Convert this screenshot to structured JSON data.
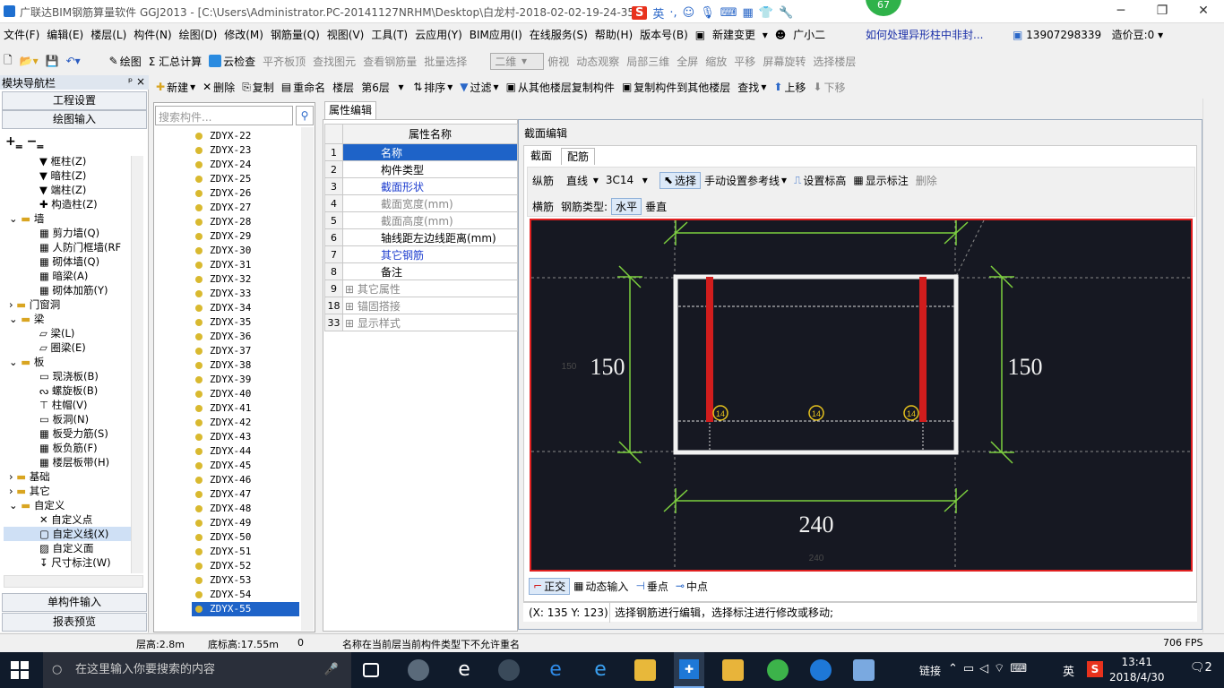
{
  "window": {
    "title": "广联达BIM钢筋算量软件 GGJ2013 - [C:\\Users\\Administrator.PC-20141127NRHM\\Desktop\\白龙村-2018-02-02-19-24-35",
    "ime_logo": "S",
    "ime_lang": "英",
    "badge": "67",
    "minimize": "─",
    "restore": "❐",
    "close": "✕"
  },
  "menu": {
    "items": [
      "文件(F)",
      "编辑(E)",
      "楼层(L)",
      "构件(N)",
      "绘图(D)",
      "修改(M)",
      "钢筋量(Q)",
      "视图(V)",
      "工具(T)",
      "云应用(Y)",
      "BIM应用(I)",
      "在线服务(S)",
      "帮助(H)",
      "版本号(B)",
      "新建变更",
      "广小二"
    ],
    "link": "如何处理异形柱中非封...",
    "phone": "13907298339",
    "price": "造价豆:0"
  },
  "toolbar1": {
    "items": [
      "绘图",
      "Σ 汇总计算",
      "云检查",
      "平齐板顶",
      "查找图元",
      "查看钢筋量",
      "批量选择",
      "二维",
      "俯视",
      "动态观察",
      "局部三维",
      "全屏",
      "缩放",
      "平移",
      "屏幕旋转",
      "选择楼层"
    ]
  },
  "toolbar2": {
    "items": [
      "新建",
      "删除",
      "复制",
      "重命名",
      "楼层",
      "第6层",
      "排序",
      "过滤",
      "从其他楼层复制构件",
      "复制构件到其他楼层",
      "查找",
      "上移",
      "下移"
    ]
  },
  "nav": {
    "title": "模块导航栏",
    "pin": "ᵖ ×",
    "btn_settings": "工程设置",
    "btn_draw": "绘图输入",
    "btn_single": "单构件输入",
    "btn_report": "报表预览",
    "tree": [
      "框柱(Z)",
      "暗柱(Z)",
      "端柱(Z)",
      "构造柱(Z)",
      "墙",
      "剪力墙(Q)",
      "人防门框墙(RF",
      "砌体墙(Q)",
      "暗梁(A)",
      "砌体加筋(Y)",
      "门窗洞",
      "梁",
      "梁(L)",
      "圈梁(E)",
      "板",
      "现浇板(B)",
      "螺旋板(B)",
      "柱帽(V)",
      "板洞(N)",
      "板受力筋(S)",
      "板负筋(F)",
      "楼层板带(H)",
      "基础",
      "其它",
      "自定义",
      "自定义点",
      "自定义线(X)",
      "自定义面",
      "尺寸标注(W)"
    ]
  },
  "complist": {
    "search_placeholder": "搜索构件...",
    "items": [
      "ZDYX-22",
      "ZDYX-23",
      "ZDYX-24",
      "ZDYX-25",
      "ZDYX-26",
      "ZDYX-27",
      "ZDYX-28",
      "ZDYX-29",
      "ZDYX-30",
      "ZDYX-31",
      "ZDYX-32",
      "ZDYX-33",
      "ZDYX-34",
      "ZDYX-35",
      "ZDYX-36",
      "ZDYX-37",
      "ZDYX-38",
      "ZDYX-39",
      "ZDYX-40",
      "ZDYX-41",
      "ZDYX-42",
      "ZDYX-43",
      "ZDYX-44",
      "ZDYX-45",
      "ZDYX-46",
      "ZDYX-47",
      "ZDYX-48",
      "ZDYX-49",
      "ZDYX-50",
      "ZDYX-51",
      "ZDYX-52",
      "ZDYX-53",
      "ZDYX-54",
      "ZDYX-55"
    ],
    "selected": "ZDYX-55"
  },
  "props": {
    "tab": "属性编辑",
    "header": "属性名称",
    "rows": [
      {
        "n": "1",
        "v": "名称"
      },
      {
        "n": "2",
        "v": "构件类型"
      },
      {
        "n": "3",
        "v": "截面形状"
      },
      {
        "n": "4",
        "v": "截面宽度(mm)"
      },
      {
        "n": "5",
        "v": "截面高度(mm)"
      },
      {
        "n": "6",
        "v": "轴线距左边线距离(mm)"
      },
      {
        "n": "7",
        "v": "其它钢筋"
      },
      {
        "n": "8",
        "v": "备注"
      },
      {
        "n": "9",
        "v": "其它属性"
      },
      {
        "n": "18",
        "v": "锚固搭接"
      },
      {
        "n": "33",
        "v": "显示样式"
      }
    ]
  },
  "dialog": {
    "title": "截面编辑",
    "tab_section": "截面",
    "tab_rebar": "配筋",
    "row1": [
      "纵筋",
      "直线",
      "3C14",
      "选择",
      "手动设置参考线",
      "设置标高",
      "显示标注",
      "删除"
    ],
    "row2": [
      "横筋",
      "钢筋类型:",
      "水平",
      "垂直"
    ],
    "dims": {
      "top": "",
      "left": "150",
      "right": "150",
      "bottom": "240",
      "faint_left": "150",
      "faint_bottom": "240"
    },
    "rebar_label": "14",
    "snap": [
      "正交",
      "动态输入",
      "垂点",
      "中点"
    ],
    "coords": "(X: 135 Y: 123)",
    "hint": "选择钢筋进行编辑，选择标注进行修改或移动;"
  },
  "status": {
    "floor_height": "层高:2.8m",
    "base_height": "底标高:17.55m",
    "zero": "0",
    "message": "名称在当前层当前构件类型下不允许重名",
    "fps": "706 FPS"
  },
  "taskbar": {
    "search": "在这里输入你要搜索的内容",
    "link": "链接",
    "lang": "英",
    "time": "13:41",
    "date": "2018/4/30",
    "notif": "2"
  }
}
